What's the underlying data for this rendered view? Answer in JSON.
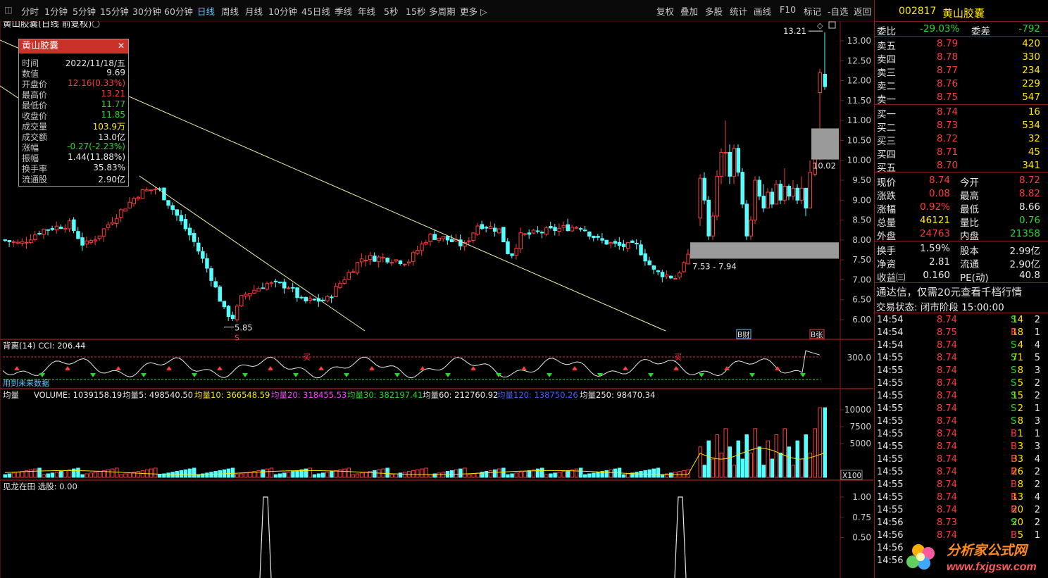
{
  "toolbar": {
    "periods": [
      "分时",
      "1分钟",
      "5分钟",
      "15分钟",
      "30分钟",
      "60分钟",
      "日线",
      "周线",
      "月线",
      "10分钟",
      "45日线",
      "季线",
      "年线",
      "5秒",
      "15秒",
      "多周期",
      "更多"
    ],
    "active": "日线",
    "tools": [
      "复权",
      "叠加",
      "多股",
      "统计",
      "画线",
      "F10",
      "标记",
      "-自选",
      "返回"
    ]
  },
  "chart": {
    "title": "黄山胶囊(日线 前复权)",
    "price_ticks": [
      "13.00",
      "12.50",
      "12.00",
      "11.50",
      "11.00",
      "10.50",
      "10.00",
      "9.50",
      "9.00",
      "8.50",
      "8.00",
      "7.50",
      "7.00",
      "6.50",
      "6.00"
    ],
    "high_label": "13.21",
    "low_label": "5.85",
    "gap_upper_label": "10.02",
    "gap_lower_label": "7.53 - 7.94",
    "marker_s": "S",
    "tag_bk": "B财",
    "tag_bn": "B张",
    "colors": {
      "up": "#ff3a3a",
      "down": "#54ffff",
      "trend": "#f0f0a0",
      "gap": "#9a9a9a",
      "axis": "#8b1a1a"
    }
  },
  "infobox": {
    "title": "黄山胶囊",
    "rows": [
      {
        "k": "时间",
        "v": "2022/11/18/五",
        "c": "#e8e8e8"
      },
      {
        "k": "数值",
        "v": "9.69",
        "c": "#e8e8e8"
      },
      {
        "k": "开盘价",
        "v": "12.16(0.33%)",
        "c": "#ff3a3a"
      },
      {
        "k": "最高价",
        "v": "13.21",
        "c": "#ff3a3a"
      },
      {
        "k": "最低价",
        "v": "11.77",
        "c": "#27d927"
      },
      {
        "k": "收盘价",
        "v": "11.85",
        "c": "#27d927"
      },
      {
        "k": "成交量",
        "v": "103.9万",
        "c": "#ffe600"
      },
      {
        "k": "成交额",
        "v": "13.0亿",
        "c": "#e8e8e8"
      },
      {
        "k": "涨幅",
        "v": "-0.27(-2.23%)",
        "c": "#27d927"
      },
      {
        "k": "振幅",
        "v": "1.44(11.88%)",
        "c": "#e8e8e8"
      },
      {
        "k": "换手率",
        "v": "35.83%",
        "c": "#e8e8e8"
      },
      {
        "k": "流通股",
        "v": "2.90亿",
        "c": "#e8e8e8"
      }
    ]
  },
  "cci": {
    "label": "背离(14)",
    "value_label": "CCI: 206.44",
    "tick": "300.0",
    "note": "用到未来数据",
    "buy_word": "买"
  },
  "volume": {
    "label": "均量",
    "items": [
      {
        "t": "VOLUME: 1039158.19",
        "c": "#e8e8e8"
      },
      {
        "t": "均量5: 498540.50",
        "c": "#e8e8e8"
      },
      {
        "t": "均量10: 366548.59",
        "c": "#ffe600"
      },
      {
        "t": "均量20: 318455.53",
        "c": "#ff40ff"
      },
      {
        "t": "均量30: 382197.41",
        "c": "#27d927"
      },
      {
        "t": "均量60: 212760.92",
        "c": "#e8e8e8"
      },
      {
        "t": "均量120: 138750.26",
        "c": "#4060ff"
      },
      {
        "t": "均量250: 98470.34",
        "c": "#e8e8e8"
      }
    ],
    "ticks": [
      "10000",
      "7500",
      "5000"
    ],
    "unit": "X100"
  },
  "signal": {
    "label": "见龙在田",
    "value_label": "选股: 0.00",
    "ticks": [
      "1.00",
      "0.75",
      "0.50"
    ]
  },
  "quote": {
    "code": "002817",
    "name": "黄山胶囊",
    "weibi": {
      "k": "委比",
      "v": "-29.03%",
      "k2": "委差",
      "v2": "-792"
    },
    "asks": [
      {
        "k": "卖五",
        "p": "8.79",
        "q": "420"
      },
      {
        "k": "卖四",
        "p": "8.78",
        "q": "330"
      },
      {
        "k": "卖三",
        "p": "8.77",
        "q": "234"
      },
      {
        "k": "卖二",
        "p": "8.76",
        "q": "229"
      },
      {
        "k": "卖一",
        "p": "8.75",
        "q": "547"
      }
    ],
    "bids": [
      {
        "k": "买一",
        "p": "8.74",
        "q": "16"
      },
      {
        "k": "买二",
        "p": "8.73",
        "q": "534"
      },
      {
        "k": "买三",
        "p": "8.72",
        "q": "32"
      },
      {
        "k": "买四",
        "p": "8.71",
        "q": "45"
      },
      {
        "k": "买五",
        "p": "8.70",
        "q": "341"
      }
    ],
    "stats": [
      {
        "k": "现价",
        "v": "8.74",
        "vc": "#ff3a3a",
        "k2": "今开",
        "v2": "8.72",
        "v2c": "#ff3a3a"
      },
      {
        "k": "涨跌",
        "v": "0.08",
        "vc": "#ff3a3a",
        "k2": "最高",
        "v2": "8.82",
        "v2c": "#ff3a3a"
      },
      {
        "k": "涨幅",
        "v": "0.92%",
        "vc": "#ff3a3a",
        "k2": "最低",
        "v2": "8.66",
        "v2c": "#e8e8e8"
      },
      {
        "k": "总量",
        "v": "46121",
        "vc": "#ffe600",
        "k2": "量比",
        "v2": "0.76",
        "v2c": "#27d927"
      },
      {
        "k": "外盘",
        "v": "24763",
        "vc": "#ff3a3a",
        "k2": "内盘",
        "v2": "21358",
        "v2c": "#27d927"
      }
    ],
    "stats2": [
      {
        "k": "换手",
        "v": "1.59%",
        "k2": "股本",
        "v2": "2.99亿"
      },
      {
        "k": "净资",
        "v": "2.81",
        "k2": "流通",
        "v2": "2.90亿"
      },
      {
        "k": "收益㈢",
        "v": "0.160",
        "k2": "PE(动)",
        "v2": "40.8"
      }
    ],
    "notice": "通达信，仅需20元查看千档行情",
    "trade_status": "交易状态: 闭市阶段 15:00:00",
    "ticks": [
      {
        "t": "14:54",
        "p": "8.74",
        "q": "14",
        "s": "S",
        "n": "2"
      },
      {
        "t": "14:54",
        "p": "8.75",
        "q": "18",
        "s": "B",
        "n": "1"
      },
      {
        "t": "14:54",
        "p": "8.74",
        "q": "4",
        "s": "S",
        "n": "4"
      },
      {
        "t": "14:55",
        "p": "8.74",
        "q": "71",
        "s": "S",
        "n": "5"
      },
      {
        "t": "14:55",
        "p": "8.74",
        "q": "8",
        "s": "S",
        "n": "3"
      },
      {
        "t": "14:55",
        "p": "8.74",
        "q": "5",
        "s": "S",
        "n": "2"
      },
      {
        "t": "14:55",
        "p": "8.74",
        "q": "15",
        "s": "S",
        "n": "2"
      },
      {
        "t": "14:55",
        "p": "8.74",
        "q": "2",
        "s": "S",
        "n": "1"
      },
      {
        "t": "14:55",
        "p": "8.74",
        "q": "8",
        "s": "S",
        "n": "3"
      },
      {
        "t": "14:55",
        "p": "8.74",
        "q": "1",
        "s": "B",
        "n": "1"
      },
      {
        "t": "14:55",
        "p": "8.74",
        "q": "3",
        "s": "B",
        "n": "3"
      },
      {
        "t": "14:55",
        "p": "8.74",
        "q": "33",
        "s": "B",
        "n": "4"
      },
      {
        "t": "14:55",
        "p": "8.74",
        "q": "26",
        "s": "B",
        "n": "2"
      },
      {
        "t": "14:55",
        "p": "8.74",
        "q": "8",
        "s": "B",
        "n": "2"
      },
      {
        "t": "14:55",
        "p": "8.74",
        "q": "13",
        "s": "B",
        "n": "4"
      },
      {
        "t": "14:55",
        "p": "8.74",
        "q": "20",
        "s": "B",
        "n": "2"
      },
      {
        "t": "14:56",
        "p": "8.73",
        "q": "20",
        "s": "S",
        "n": "2"
      },
      {
        "t": "14:56",
        "p": "8.74",
        "q": "5",
        "s": "B",
        "n": "1"
      },
      {
        "t": "14:56",
        "p": "",
        "q": "",
        "s": "",
        "n": ""
      },
      {
        "t": "14:56",
        "p": "",
        "q": "",
        "s": "",
        "n": ""
      }
    ]
  },
  "logo": {
    "line1": "分析家公式网",
    "line2": "www.fxjgsw.com"
  }
}
